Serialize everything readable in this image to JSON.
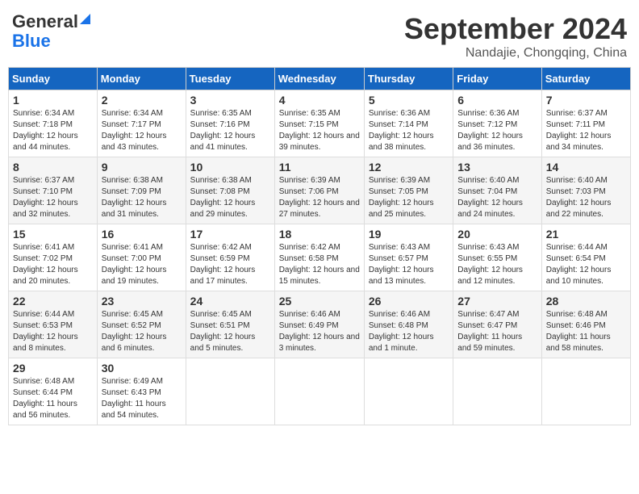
{
  "header": {
    "logo_general": "General",
    "logo_blue": "Blue",
    "title": "September 2024",
    "subtitle": "Nandajie, Chongqing, China"
  },
  "columns": [
    "Sunday",
    "Monday",
    "Tuesday",
    "Wednesday",
    "Thursday",
    "Friday",
    "Saturday"
  ],
  "weeks": [
    [
      {
        "day": "1",
        "sunrise": "Sunrise: 6:34 AM",
        "sunset": "Sunset: 7:18 PM",
        "daylight": "Daylight: 12 hours and 44 minutes."
      },
      {
        "day": "2",
        "sunrise": "Sunrise: 6:34 AM",
        "sunset": "Sunset: 7:17 PM",
        "daylight": "Daylight: 12 hours and 43 minutes."
      },
      {
        "day": "3",
        "sunrise": "Sunrise: 6:35 AM",
        "sunset": "Sunset: 7:16 PM",
        "daylight": "Daylight: 12 hours and 41 minutes."
      },
      {
        "day": "4",
        "sunrise": "Sunrise: 6:35 AM",
        "sunset": "Sunset: 7:15 PM",
        "daylight": "Daylight: 12 hours and 39 minutes."
      },
      {
        "day": "5",
        "sunrise": "Sunrise: 6:36 AM",
        "sunset": "Sunset: 7:14 PM",
        "daylight": "Daylight: 12 hours and 38 minutes."
      },
      {
        "day": "6",
        "sunrise": "Sunrise: 6:36 AM",
        "sunset": "Sunset: 7:12 PM",
        "daylight": "Daylight: 12 hours and 36 minutes."
      },
      {
        "day": "7",
        "sunrise": "Sunrise: 6:37 AM",
        "sunset": "Sunset: 7:11 PM",
        "daylight": "Daylight: 12 hours and 34 minutes."
      }
    ],
    [
      {
        "day": "8",
        "sunrise": "Sunrise: 6:37 AM",
        "sunset": "Sunset: 7:10 PM",
        "daylight": "Daylight: 12 hours and 32 minutes."
      },
      {
        "day": "9",
        "sunrise": "Sunrise: 6:38 AM",
        "sunset": "Sunset: 7:09 PM",
        "daylight": "Daylight: 12 hours and 31 minutes."
      },
      {
        "day": "10",
        "sunrise": "Sunrise: 6:38 AM",
        "sunset": "Sunset: 7:08 PM",
        "daylight": "Daylight: 12 hours and 29 minutes."
      },
      {
        "day": "11",
        "sunrise": "Sunrise: 6:39 AM",
        "sunset": "Sunset: 7:06 PM",
        "daylight": "Daylight: 12 hours and 27 minutes."
      },
      {
        "day": "12",
        "sunrise": "Sunrise: 6:39 AM",
        "sunset": "Sunset: 7:05 PM",
        "daylight": "Daylight: 12 hours and 25 minutes."
      },
      {
        "day": "13",
        "sunrise": "Sunrise: 6:40 AM",
        "sunset": "Sunset: 7:04 PM",
        "daylight": "Daylight: 12 hours and 24 minutes."
      },
      {
        "day": "14",
        "sunrise": "Sunrise: 6:40 AM",
        "sunset": "Sunset: 7:03 PM",
        "daylight": "Daylight: 12 hours and 22 minutes."
      }
    ],
    [
      {
        "day": "15",
        "sunrise": "Sunrise: 6:41 AM",
        "sunset": "Sunset: 7:02 PM",
        "daylight": "Daylight: 12 hours and 20 minutes."
      },
      {
        "day": "16",
        "sunrise": "Sunrise: 6:41 AM",
        "sunset": "Sunset: 7:00 PM",
        "daylight": "Daylight: 12 hours and 19 minutes."
      },
      {
        "day": "17",
        "sunrise": "Sunrise: 6:42 AM",
        "sunset": "Sunset: 6:59 PM",
        "daylight": "Daylight: 12 hours and 17 minutes."
      },
      {
        "day": "18",
        "sunrise": "Sunrise: 6:42 AM",
        "sunset": "Sunset: 6:58 PM",
        "daylight": "Daylight: 12 hours and 15 minutes."
      },
      {
        "day": "19",
        "sunrise": "Sunrise: 6:43 AM",
        "sunset": "Sunset: 6:57 PM",
        "daylight": "Daylight: 12 hours and 13 minutes."
      },
      {
        "day": "20",
        "sunrise": "Sunrise: 6:43 AM",
        "sunset": "Sunset: 6:55 PM",
        "daylight": "Daylight: 12 hours and 12 minutes."
      },
      {
        "day": "21",
        "sunrise": "Sunrise: 6:44 AM",
        "sunset": "Sunset: 6:54 PM",
        "daylight": "Daylight: 12 hours and 10 minutes."
      }
    ],
    [
      {
        "day": "22",
        "sunrise": "Sunrise: 6:44 AM",
        "sunset": "Sunset: 6:53 PM",
        "daylight": "Daylight: 12 hours and 8 minutes."
      },
      {
        "day": "23",
        "sunrise": "Sunrise: 6:45 AM",
        "sunset": "Sunset: 6:52 PM",
        "daylight": "Daylight: 12 hours and 6 minutes."
      },
      {
        "day": "24",
        "sunrise": "Sunrise: 6:45 AM",
        "sunset": "Sunset: 6:51 PM",
        "daylight": "Daylight: 12 hours and 5 minutes."
      },
      {
        "day": "25",
        "sunrise": "Sunrise: 6:46 AM",
        "sunset": "Sunset: 6:49 PM",
        "daylight": "Daylight: 12 hours and 3 minutes."
      },
      {
        "day": "26",
        "sunrise": "Sunrise: 6:46 AM",
        "sunset": "Sunset: 6:48 PM",
        "daylight": "Daylight: 12 hours and 1 minute."
      },
      {
        "day": "27",
        "sunrise": "Sunrise: 6:47 AM",
        "sunset": "Sunset: 6:47 PM",
        "daylight": "Daylight: 11 hours and 59 minutes."
      },
      {
        "day": "28",
        "sunrise": "Sunrise: 6:48 AM",
        "sunset": "Sunset: 6:46 PM",
        "daylight": "Daylight: 11 hours and 58 minutes."
      }
    ],
    [
      {
        "day": "29",
        "sunrise": "Sunrise: 6:48 AM",
        "sunset": "Sunset: 6:44 PM",
        "daylight": "Daylight: 11 hours and 56 minutes."
      },
      {
        "day": "30",
        "sunrise": "Sunrise: 6:49 AM",
        "sunset": "Sunset: 6:43 PM",
        "daylight": "Daylight: 11 hours and 54 minutes."
      },
      null,
      null,
      null,
      null,
      null
    ]
  ]
}
